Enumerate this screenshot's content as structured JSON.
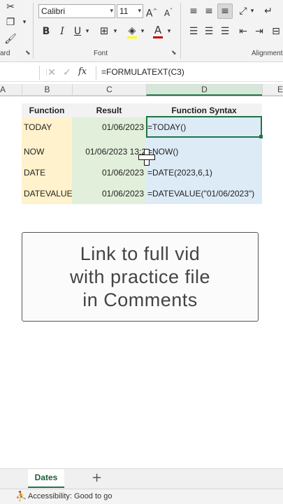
{
  "ribbon": {
    "font_name": "Calibri",
    "font_size": "11",
    "clipboard_label": "ard",
    "font_label": "Font",
    "alignment_label": "Alignment",
    "bold": "B",
    "italic": "I",
    "underline": "U",
    "grow_font": "A",
    "shrink_font": "A",
    "font_color_glyph": "A",
    "accent_red": "#c00000",
    "fill_yellow": "#ffff00"
  },
  "formula_bar": {
    "fx": "fx",
    "formula": "=FORMULATEXT(C3)"
  },
  "columns": [
    "A",
    "B",
    "C",
    "D",
    "E"
  ],
  "table": {
    "headers": [
      "Function",
      "Result",
      "Function Syntax"
    ],
    "rows": [
      {
        "fn": "TODAY",
        "result": "01/06/2023",
        "syntax": "=TODAY()"
      },
      {
        "fn": "NOW",
        "result": "01/06/2023 13:2",
        "syntax": "=NOW()"
      },
      {
        "fn": "DATE",
        "result": "01/06/2023",
        "syntax": "=DATE(2023,6,1)"
      },
      {
        "fn": "DATEVALUE",
        "result": "01/06/2023",
        "syntax": "=DATEVALUE(\"01/06/2023\")"
      }
    ],
    "colors": {
      "fn_bg": "#fff2cc",
      "result_bg": "#e2efda",
      "syntax_bg": "#ddebf7",
      "selected_border": "#217346"
    }
  },
  "note": {
    "lines": [
      "Link to full vid",
      "with practice file",
      "in Comments"
    ]
  },
  "sheet_tabs": {
    "active": "Dates",
    "add": "+"
  },
  "status": {
    "accessibility": "Accessibility: Good to go"
  }
}
